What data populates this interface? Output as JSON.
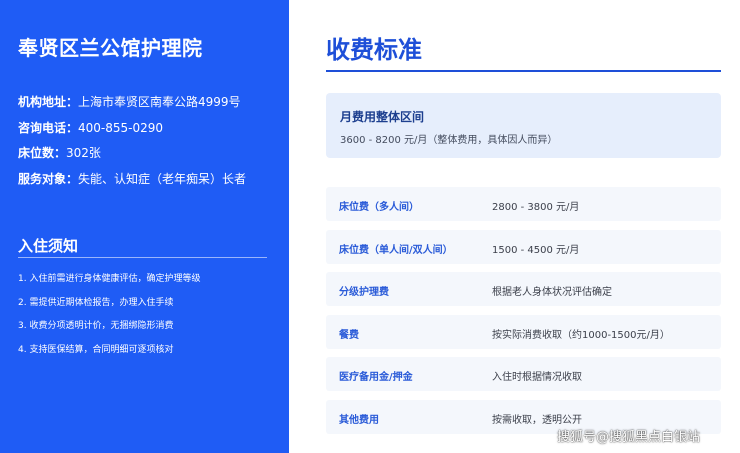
{
  "sidebar": {
    "org_name": "奉贤区兰公馆护理院",
    "info": [
      {
        "label": "机构地址：",
        "value": "上海市奉贤区南奉公路4999号"
      },
      {
        "label": "咨询电话：",
        "value": "400-855-0290"
      },
      {
        "label": "床位数：",
        "value": "302张"
      },
      {
        "label": "服务对象：",
        "value": "失能、认知症（老年痴呆）长者"
      }
    ],
    "notice_title": "入住须知",
    "notices": [
      "1. 入住前需进行身体健康评估，确定护理等级",
      "2. 需提供近期体检报告，办理入住手续",
      "3. 收费分项透明计价，无捆绑隐形消费",
      "4. 支持医保结算，合同明细可逐项核对"
    ]
  },
  "main": {
    "title": "收费标准",
    "range": {
      "label": "月费用整体区间",
      "value": "3600 - 8200 元/月（整体费用，具体因人而异）"
    },
    "fees": [
      {
        "name": "床位费（多人间）",
        "value": "2800 - 3800 元/月"
      },
      {
        "name": "床位费（单人间/双人间）",
        "value": "1500 - 4500 元/月"
      },
      {
        "name": "分级护理费",
        "value": "根据老人身体状况评估确定"
      },
      {
        "name": "餐费",
        "value": "按实际消费收取（约1000-1500元/月）"
      },
      {
        "name": "医疗备用金/押金",
        "value": "入住时根据情况收取"
      },
      {
        "name": "其他费用",
        "value": "按需收取，透明公开"
      }
    ]
  },
  "watermark": "搜狐号@搜狐黑点白银站",
  "colors": {
    "sidebar_bg": "#1f5cf5",
    "accent": "#1e4fd8",
    "range_bg": "#e6eefc",
    "row_bg": "#f4f7fc"
  }
}
